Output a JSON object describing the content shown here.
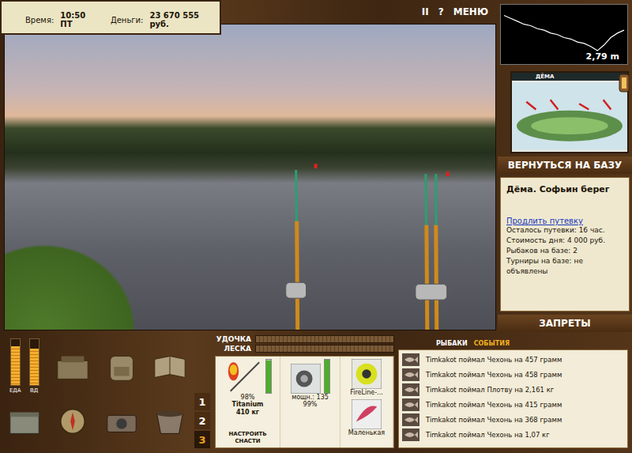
{
  "status": {
    "time_label": "Время:",
    "time": "10:50 ПТ",
    "money_label": "Деньги:",
    "money": "23 670 555 руб."
  },
  "top_controls": [
    "II",
    "?",
    "МЕНЮ"
  ],
  "depth_chart": {
    "reading": "2,79 m",
    "values": [
      0.4,
      0.6,
      0.8,
      1.0,
      1.1,
      1.3,
      1.4,
      1.6,
      1.7,
      1.9,
      2.0,
      2.2,
      2.3,
      2.5,
      2.79,
      2.4,
      1.9,
      1.6,
      1.4
    ]
  },
  "map_card": {
    "title": "ДЁМА"
  },
  "return_button": "ВЕРНУТЬСЯ НА БАЗУ",
  "location": {
    "title": "Дёма. Софьин берег",
    "link": "Продлить путевку",
    "lines": [
      "Осталось путевки: 16 час.",
      "Стоимость дня: 4 000 руб.",
      "Рыбаков на базе: 2",
      "Турниры на базе: не объявлены"
    ]
  },
  "bans_button": "ЗАПРЕТЫ",
  "meters": [
    {
      "label": "ЕДА",
      "level": 0.85
    },
    {
      "label": "ВД",
      "level": 0.8
    }
  ],
  "tension_bars": [
    {
      "label": "УДОЧКА",
      "level": 0
    },
    {
      "label": "ЛЕСКА",
      "level": 0
    }
  ],
  "rod_tabs": [
    {
      "label": "1",
      "selected": false
    },
    {
      "label": "2",
      "selected": false
    },
    {
      "label": "3",
      "selected": true
    }
  ],
  "gear": {
    "rod": {
      "name": "Titanium",
      "load": "410 кг",
      "condition": "98%",
      "level": 0.98
    },
    "reel": {
      "power": "мощн.: 135",
      "condition": "99%",
      "level": 0.99
    },
    "line": {
      "name": "FireLine-..."
    },
    "lure": {
      "name": "Маленькая"
    },
    "setup_button": "НАСТРОИТЬ СНАСТИ"
  },
  "event_tabs": [
    {
      "label": "РЫБАКИ",
      "selected": false
    },
    {
      "label": "СОБЫТИЯ",
      "selected": true
    }
  ],
  "events": [
    "Timkakot поймал Чехонь на 457 грамм",
    "Timkakot поймал Чехонь на 458 грамм",
    "Timkakot поймал Плотву на 2,161 кг",
    "Timkakot поймал Чехонь на 415 грамм",
    "Timkakot поймал Чехонь на 368 грамм",
    "Timkakot поймал Чехонь на 1,07 кг"
  ]
}
